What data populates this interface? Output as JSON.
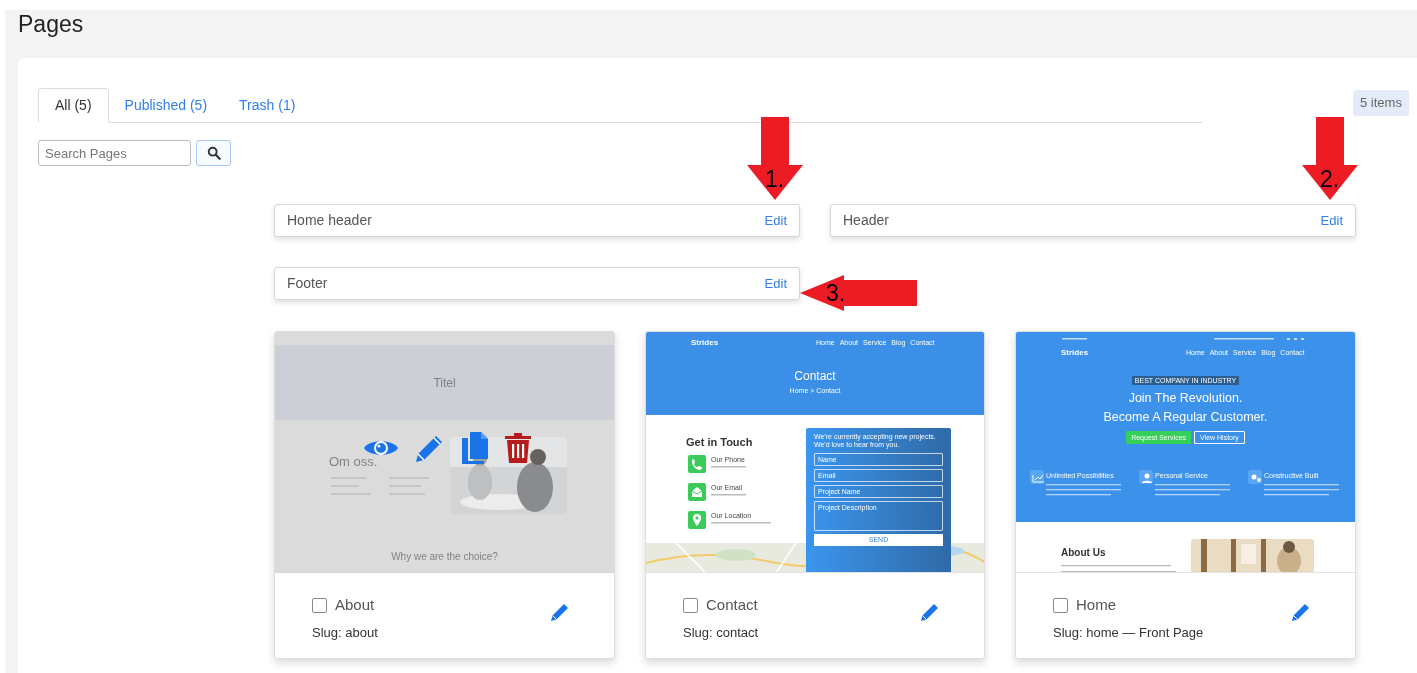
{
  "title": "Pages",
  "tabs": [
    {
      "label": "All (5)",
      "selected": true
    },
    {
      "label": "Published (5)",
      "selected": false
    },
    {
      "label": "Trash (1)",
      "selected": false
    }
  ],
  "item_count": "5 items",
  "search": {
    "placeholder": "Search Pages"
  },
  "templates": [
    {
      "name": "Home header",
      "action": "Edit"
    },
    {
      "name": "Header",
      "action": "Edit"
    },
    {
      "name": "Footer",
      "action": "Edit"
    }
  ],
  "annotations": [
    {
      "kind": "down",
      "label": "1."
    },
    {
      "kind": "down",
      "label": "2."
    },
    {
      "kind": "left",
      "label": "3."
    }
  ],
  "pages": [
    {
      "title": "About",
      "slug": "Slug: about",
      "checked": false,
      "hovered": true,
      "thumbnail": {
        "kind": "about",
        "heading": "Titel",
        "section_title": "Om oss.",
        "subheading": "Why we are the choice?"
      }
    },
    {
      "title": "Contact",
      "slug": "Slug: contact",
      "checked": false,
      "hovered": false,
      "thumbnail": {
        "kind": "contact",
        "brand": "Strides",
        "nav": [
          "Home",
          "About",
          "Service",
          "Blog",
          "Contact"
        ],
        "heading": "Contact",
        "breadcrumb": "Home > Contact",
        "section_title": "Get in Touch",
        "contacts": [
          "Our Phone",
          "Our Email",
          "Our Location"
        ],
        "form_intro": "We're currently accepting new projects. We'd love to hear from you.",
        "form_fields": [
          "Name",
          "Email",
          "Project Name",
          "Project Description"
        ],
        "submit": "SEND"
      }
    },
    {
      "title": "Home",
      "slug": "Slug: home — Front Page",
      "checked": false,
      "hovered": false,
      "thumbnail": {
        "kind": "home",
        "brand": "Strides",
        "nav": [
          "Home",
          "About",
          "Service",
          "Blog",
          "Contact"
        ],
        "badge": "BEST COMPANY IN INDUSTRY",
        "headline": [
          "Join The Revolution.",
          "Become A Regular Customer."
        ],
        "buttons": [
          "Request Services",
          "View History"
        ],
        "features": [
          "Unlimited Possibilities",
          "Personal Service",
          "Constructive Built"
        ],
        "section_title": "About Us"
      }
    }
  ]
}
